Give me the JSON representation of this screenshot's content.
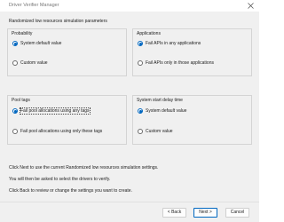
{
  "window": {
    "title": "Driver Verifier Manager",
    "close_glyph": "✕"
  },
  "heading": "Randomized low resources simulation parameters",
  "groups": {
    "probability": {
      "title": "Probability",
      "options": [
        "System default value",
        "Custom value"
      ],
      "selected": 0
    },
    "applications": {
      "title": "Applications",
      "options": [
        "Fail APIs in any applications",
        "Fail APIs only in those applications"
      ],
      "selected": 0
    },
    "pool_tags": {
      "title": "Pool tags",
      "options": [
        "Fail pool allocations using any tags",
        "Fail pool allocations using only these tags"
      ],
      "selected": 0
    },
    "start_delay": {
      "title": "System start delay time",
      "options": [
        "System default value",
        "Custom value"
      ],
      "selected": 0
    }
  },
  "info": [
    "Click Next to use the current Randomized low resources simulation settings.",
    "You will then be asked to select the drivers to verify.",
    "Click Back to review or change the settings you want to create."
  ],
  "buttons": {
    "back": "< Back",
    "next": "Next >",
    "cancel": "Cancel"
  },
  "colors": {
    "accent": "#0067c0",
    "window_bg": "#f0f0f0"
  }
}
